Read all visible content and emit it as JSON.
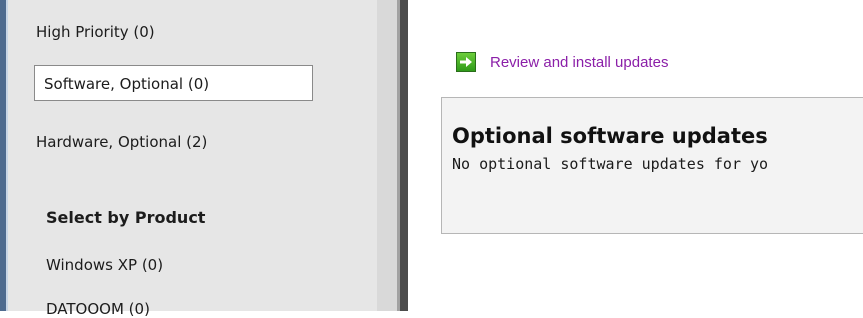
{
  "sidebar": {
    "filters": [
      {
        "label": "High Priority (0)"
      },
      {
        "label": "Software, Optional (0)"
      },
      {
        "label": "Hardware, Optional (2)"
      }
    ],
    "section_header": "Select by Product",
    "products": [
      {
        "label": "Windows XP (0)"
      },
      {
        "label": "DATOOOM (0)"
      }
    ]
  },
  "main": {
    "review_link": "Review and install updates",
    "panel": {
      "title": "Optional software updates",
      "message": "No optional software updates for yo"
    }
  },
  "icons": {
    "review": "green-arrow-icon"
  },
  "colors": {
    "link": "#8b1fa8",
    "sidebar_bg": "#e6e6e6",
    "panel_bg": "#f3f3f3"
  }
}
